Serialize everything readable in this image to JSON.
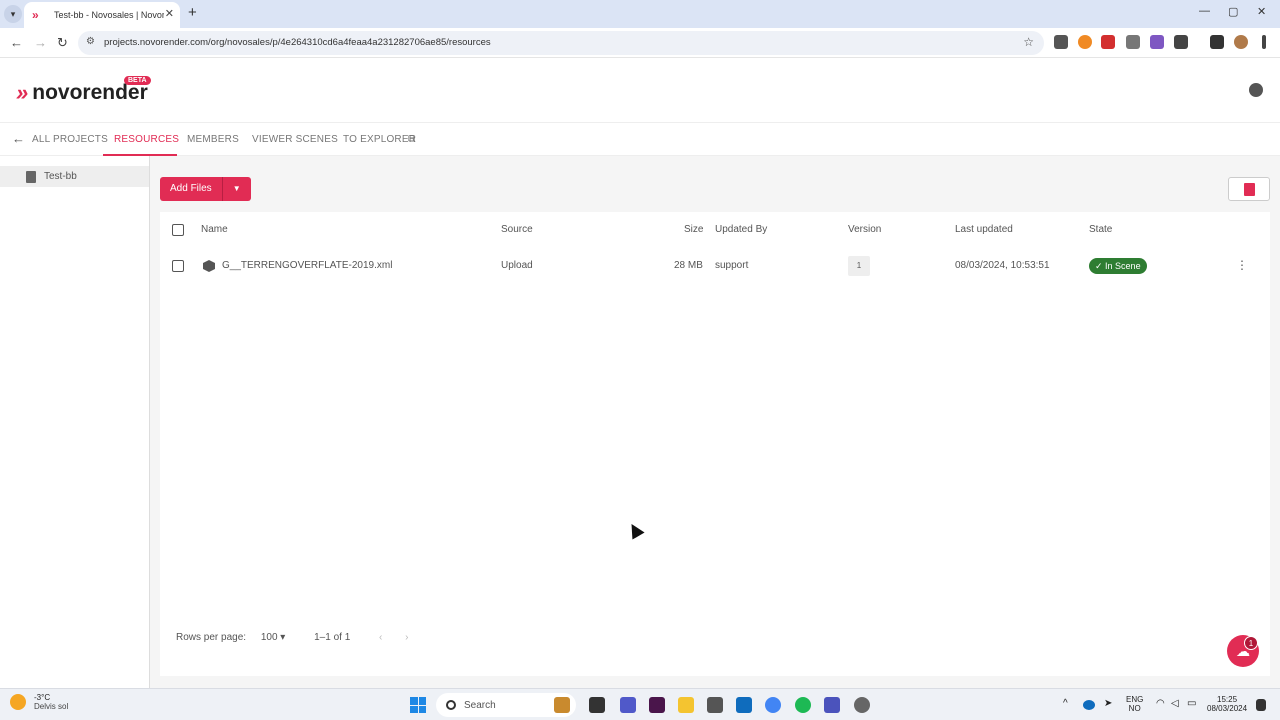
{
  "browser": {
    "tab_title": "Test-bb - Novosales | Novorender",
    "url": "projects.novorender.com/org/novosales/p/4e264310cd6a4feaa4a231282706ae85/resources"
  },
  "app": {
    "brand": "novorender",
    "beta_label": "BETA",
    "accent_color": "#e12c54"
  },
  "nav": {
    "back_label": "ALL PROJECTS",
    "tabs": [
      {
        "label": "RESOURCES",
        "active": true
      },
      {
        "label": "MEMBERS",
        "active": false
      },
      {
        "label": "VIEWER SCENES",
        "active": false
      },
      {
        "label": "TO EXPLORER",
        "active": false
      }
    ]
  },
  "sidebar": {
    "items": [
      {
        "label": "Test-bb",
        "icon": "book-icon"
      }
    ]
  },
  "toolbar": {
    "add_files_label": "Add Files"
  },
  "table": {
    "columns": [
      "Name",
      "Source",
      "Size",
      "Updated By",
      "Version",
      "Last updated",
      "State"
    ],
    "rows": [
      {
        "name": "G__TERRENGOVERFLATE-2019.xml",
        "source": "Upload",
        "size": "28 MB",
        "updated_by": "support",
        "version": "1",
        "last_updated": "08/03/2024, 10:53:51",
        "state": "In Scene",
        "state_color": "#2e7d32"
      }
    ]
  },
  "pagination": {
    "rows_per_page_label": "Rows per page:",
    "rows_per_page": "100",
    "range": "1–1 of 1"
  },
  "fab": {
    "badge": "1"
  },
  "taskbar": {
    "temperature": "-3°C",
    "weather": "Delvis sol",
    "search_label": "Search",
    "lang_line1": "ENG",
    "lang_line2": "NO",
    "time": "15:25",
    "date": "08/03/2024"
  }
}
